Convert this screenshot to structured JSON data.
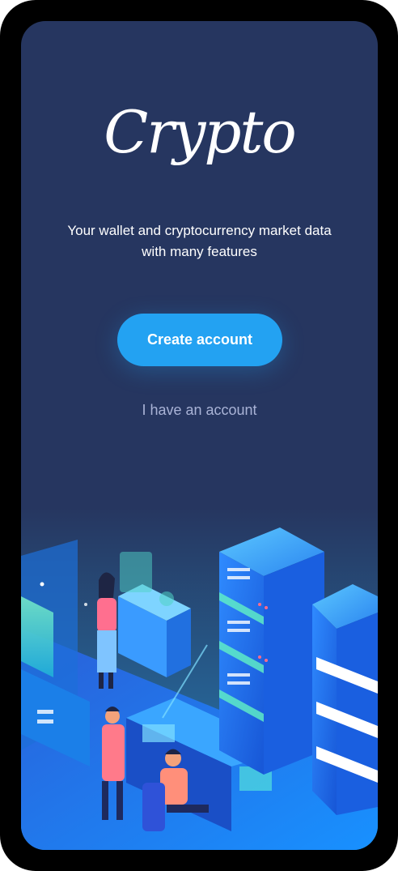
{
  "app": {
    "logo_text": "Crypto",
    "tagline_line1": "Your wallet and cryptocurrency market data",
    "tagline_line2": "with many features"
  },
  "actions": {
    "create_account_label": "Create account",
    "have_account_label": "I have an account"
  },
  "colors": {
    "background": "#263660",
    "primary_button": "#23a2f2",
    "secondary_text": "#a9b3d6",
    "illustration_accent": "#2ec6ff"
  },
  "illustration": {
    "icon": "data-center-illustration"
  }
}
